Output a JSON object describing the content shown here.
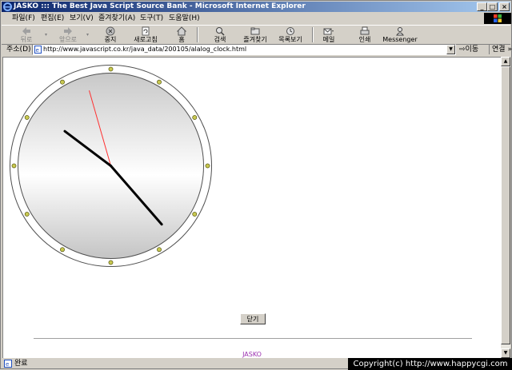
{
  "window": {
    "title": "JASKO ::: The Best Java Script Source Bank - Microsoft Internet Explorer"
  },
  "menu": {
    "items": [
      {
        "label": "파일(F)"
      },
      {
        "label": "편집(E)"
      },
      {
        "label": "보기(V)"
      },
      {
        "label": "즐겨찾기(A)"
      },
      {
        "label": "도구(T)"
      },
      {
        "label": "도움말(H)"
      }
    ]
  },
  "toolbar": {
    "back": "뒤로",
    "forward": "앞으로",
    "stop": "중지",
    "refresh": "새로고침",
    "home": "홈",
    "search": "검색",
    "favorites": "즐겨찾기",
    "history": "목록보기",
    "mail": "메일",
    "print": "인쇄",
    "messenger": "Messenger"
  },
  "address": {
    "label": "주소(D)",
    "url": "http://www.javascript.co.kr/java_data/200105/alalog_clock.html",
    "go": "이동",
    "links": "연결"
  },
  "page": {
    "close_button": "닫기",
    "footer": "JASKO"
  },
  "clock": {
    "hour_angle_deg": 307,
    "minute_angle_deg": 139,
    "second_angle_deg": 344,
    "dot_count": 12
  },
  "status": {
    "text": "완료",
    "copyright": "Copyright(c) http://www.happycgi.com"
  },
  "colors": {
    "titlebar_start": "#0a246a",
    "titlebar_end": "#a6caf0",
    "second_hand": "#ff3030",
    "dot_fill": "#c8c850",
    "footer_text": "#9b30b0"
  }
}
